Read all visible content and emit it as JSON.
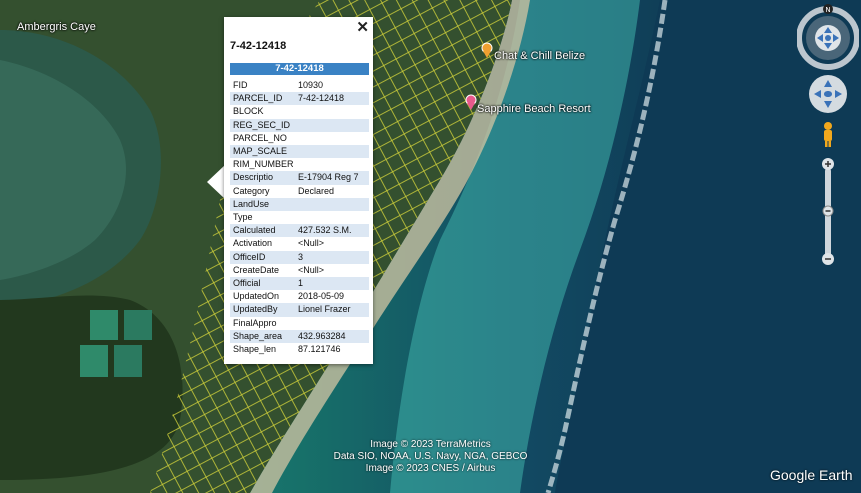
{
  "map": {
    "place_label": "Ambergris Caye",
    "pois": [
      {
        "name": "Chat & Chill Belize",
        "color": "#f0a030"
      },
      {
        "name": "Sapphire Beach Resort",
        "color": "#e75a8c"
      }
    ]
  },
  "popup": {
    "title": "7-42-12418",
    "header": "7-42-12418",
    "close_glyph": "✕",
    "rows": [
      {
        "key": "FID",
        "value": "10930"
      },
      {
        "key": "PARCEL_ID",
        "value": "7-42-12418"
      },
      {
        "key": "BLOCK",
        "value": ""
      },
      {
        "key": "REG_SEC_ID",
        "value": ""
      },
      {
        "key": "PARCEL_NO",
        "value": ""
      },
      {
        "key": "MAP_SCALE",
        "value": ""
      },
      {
        "key": "RIM_NUMBER",
        "value": ""
      },
      {
        "key": "Descriptio",
        "value": "E-17904 Reg 7"
      },
      {
        "key": "Category",
        "value": "Declared"
      },
      {
        "key": "LandUse",
        "value": ""
      },
      {
        "key": "Type",
        "value": ""
      },
      {
        "key": "Calculated",
        "value": "427.532 S.M."
      },
      {
        "key": "Activation",
        "value": "<Null>"
      },
      {
        "key": "OfficeID",
        "value": "3"
      },
      {
        "key": "CreateDate",
        "value": "<Null>"
      },
      {
        "key": "Official",
        "value": "1"
      },
      {
        "key": "UpdatedOn",
        "value": "2018-05-09"
      },
      {
        "key": "UpdatedBy",
        "value": "Lionel Frazer"
      },
      {
        "key": "FinalAppro",
        "value": ""
      },
      {
        "key": "Shape_area",
        "value": "432.963284"
      },
      {
        "key": "Shape_len",
        "value": "87.121746"
      }
    ]
  },
  "nav": {
    "compass_label": "N"
  },
  "credits": [
    "Image © 2023 TerraMetrics",
    "Data SIO, NOAA, U.S. Navy, NGA, GEBCO",
    "Image © 2023 CNES / Airbus"
  ],
  "brand": "Google Earth",
  "colors": {
    "land": "#35512f",
    "land_dark": "#26391f",
    "lagoon": "#1f7e77",
    "reef_shallow": "#2aa3a1",
    "deep_sea": "#0f3750",
    "parcel_lines": "#dada3a",
    "popup_header": "#3a82c4"
  }
}
